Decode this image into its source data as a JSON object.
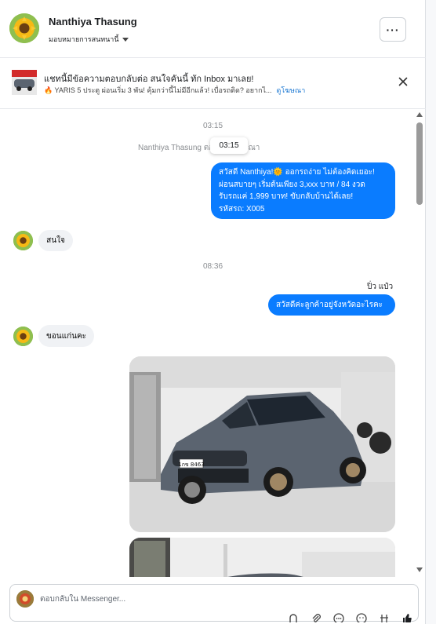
{
  "header": {
    "contact_name": "Nanthiya Thasung",
    "assign_label": "มอบหมายการสนทนานี้",
    "more_label": "···"
  },
  "ad_banner": {
    "title": "แชทนี้มีข้อความตอบกลับต่อ สนใจคันนี้ ทัก Inbox มาเลย!",
    "subtitle": "🔥 YARIS 5 ประตู ผ่อนเริ่ม 3 พัน! คุ้มกว่านี้ไม่มีอีกแล้ว! เบื่อรถติด? อยากไ...",
    "link_label": "ดูโฆษณา"
  },
  "chat": {
    "messages": [
      {
        "kind": "time",
        "text": "03:15"
      },
      {
        "kind": "system",
        "text": "Nanthiya Thasung ตอบกลับโฆษณา",
        "tooltip": "03:15"
      },
      {
        "kind": "outgoing",
        "lines": [
          "สวัสดี Nanthiya!🌞 ออกรถง่าย ไม่ต้องคิดเยอะ!",
          "ผ่อนสบายๆ เริ่มต้นเพียง 3,xxx บาท / 84 งวด",
          "รับรถแค่ 1,999 บาท! ขับกลับบ้านได้เลย!",
          "รหัสรถ: X005"
        ]
      },
      {
        "kind": "incoming",
        "text": "สนใจ"
      },
      {
        "kind": "time",
        "text": "08:36"
      },
      {
        "kind": "sender",
        "text": "ปิ่ว แป๋ว"
      },
      {
        "kind": "outgoing",
        "text": "สวัสดีค่ะลูกค้าอยู่จังหวัดอะไรคะ"
      },
      {
        "kind": "incoming",
        "text": "ขอนแก่นคะ"
      },
      {
        "kind": "photo",
        "plate": "1กข 8463"
      },
      {
        "kind": "photo"
      }
    ]
  },
  "composer": {
    "placeholder": "ตอบกลับใน Messenger..."
  },
  "colors": {
    "outgoing_bubble": "#0a7cff",
    "incoming_bubble": "#f0f2f5",
    "link": "#1876d2"
  }
}
